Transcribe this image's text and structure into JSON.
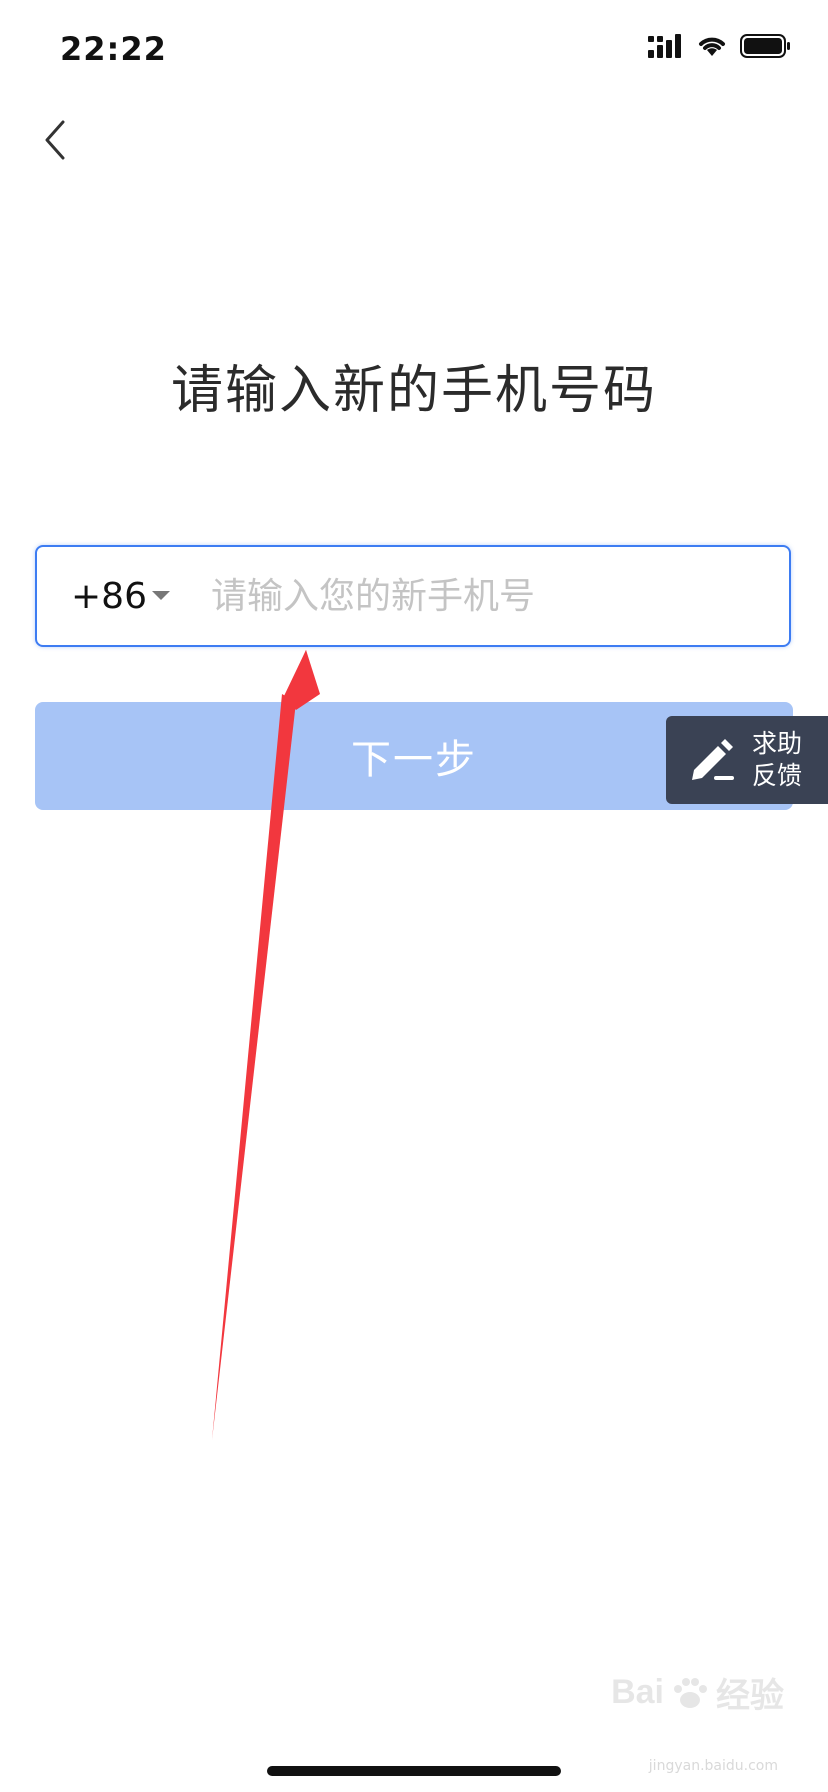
{
  "status_bar": {
    "time": "22:22",
    "icons": [
      "signal-icon",
      "wifi-icon",
      "battery-icon"
    ]
  },
  "nav": {
    "back_icon": "chevron-left-icon"
  },
  "page": {
    "title": "请输入新的手机号码"
  },
  "phone_field": {
    "country_code": "+86",
    "value": "",
    "placeholder": "请输入您的新手机号"
  },
  "next_button": {
    "label": "下一步"
  },
  "feedback": {
    "line1": "求助",
    "line2": "反馈",
    "icon": "pencil-icon"
  },
  "watermark": {
    "text": "Bai",
    "text2": "经验",
    "sub": "jingyan.baidu.com"
  },
  "colors": {
    "accent": "#3d7cf2",
    "button_disabled": "#a7c4f6",
    "feedback_bg": "#3a4254",
    "annotation": "#f2373e"
  }
}
